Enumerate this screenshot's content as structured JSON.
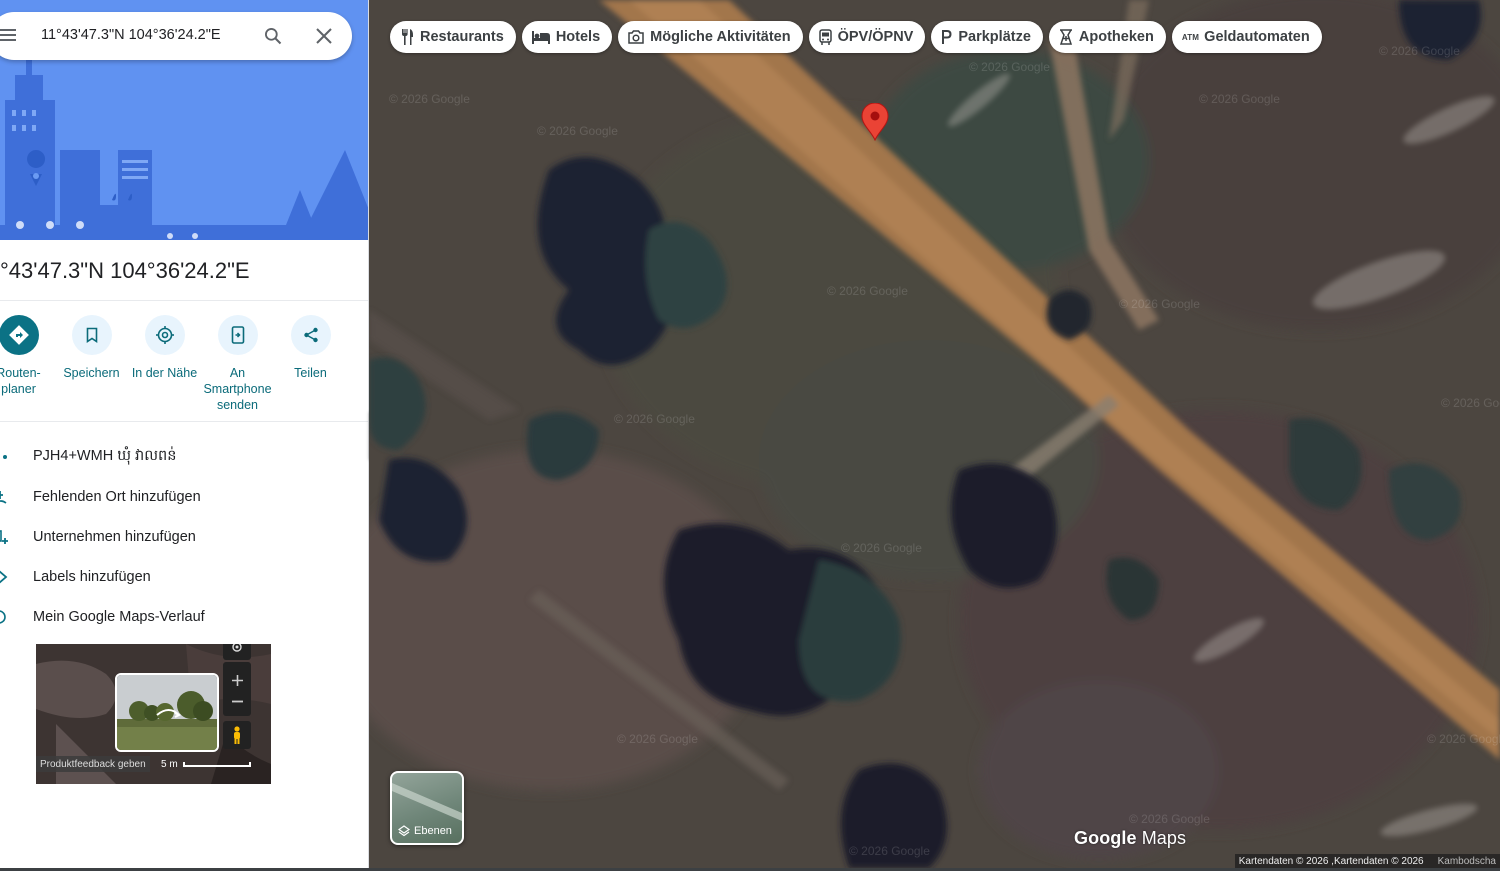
{
  "search": {
    "query": "11°43'47.3\"N 104°36'24.2\"E"
  },
  "place": {
    "title": "°43'47.3\"N 104°36'24.2\"E"
  },
  "actions": [
    {
      "label": "Routen-\nplaner",
      "icon": "directions-icon"
    },
    {
      "label": "Speichern",
      "icon": "bookmark-icon"
    },
    {
      "label": "In der Nähe",
      "icon": "nearby-icon"
    },
    {
      "label": "An Smartphone senden",
      "icon": "send-to-phone-icon"
    },
    {
      "label": "Teilen",
      "icon": "share-icon"
    }
  ],
  "info_rows": [
    {
      "label": "PJH4+WMH ឃុំ វាលពន់",
      "icon": "plus-code-icon"
    },
    {
      "label": "Fehlenden Ort hinzufügen",
      "icon": "add-place-icon"
    },
    {
      "label": "Unternehmen hinzufügen",
      "icon": "add-business-icon"
    },
    {
      "label": "Labels hinzufügen",
      "icon": "label-icon"
    },
    {
      "label": "Mein Google Maps-Verlauf",
      "icon": "history-icon"
    }
  ],
  "street_view": {
    "feedback": "Produktfeedback geben",
    "scale": "5 m"
  },
  "chips": [
    {
      "label": "Restaurants",
      "icon": "restaurant-icon"
    },
    {
      "label": "Hotels",
      "icon": "hotel-icon"
    },
    {
      "label": "Mögliche Aktivitäten",
      "icon": "camera-icon"
    },
    {
      "label": "ÖPV/ÖPNV",
      "icon": "transit-icon"
    },
    {
      "label": "Parkplätze",
      "icon": "parking-icon"
    },
    {
      "label": "Apotheken",
      "icon": "pharmacy-icon"
    },
    {
      "label": "Geldautomaten",
      "icon": "atm-icon"
    }
  ],
  "atm_badge": "ATM",
  "map": {
    "watermark": "© 2026 Google",
    "logo_google": "Google",
    "logo_maps": " Maps",
    "attribution": "Kartendaten © 2026 ,Kartendaten © 2026",
    "country": "Kambodscha",
    "layers_label": "Ebenen"
  },
  "colors": {
    "accent": "#0b7285",
    "pin": "#ea4335",
    "hero": "#5b8ef0"
  }
}
